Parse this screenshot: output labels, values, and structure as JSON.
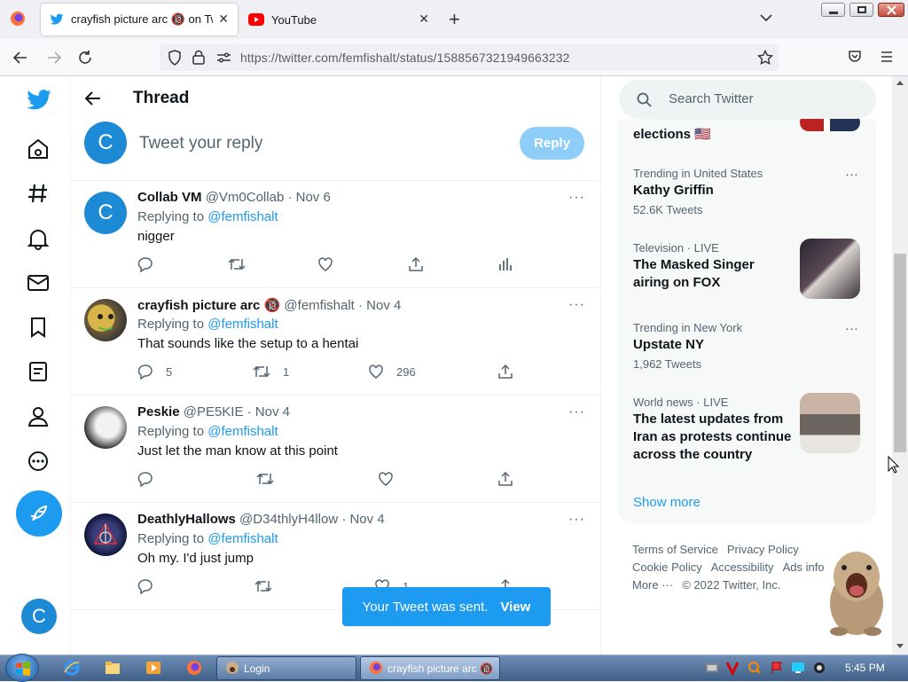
{
  "browser": {
    "tabs": [
      {
        "title": "crayfish picture arc 🔞 on Twitte",
        "close": "✕"
      },
      {
        "title": "YouTube",
        "close": "✕"
      }
    ],
    "new_tab": "+",
    "url": "https://twitter.com/femfishalt/status/1588567321949663232"
  },
  "header": {
    "title": "Thread"
  },
  "reply": {
    "avatar": "C",
    "placeholder": "Tweet your reply",
    "button": "Reply"
  },
  "tweets": [
    {
      "name": "Collab VM",
      "handle": "@Vm0Collab · Nov 6",
      "replying": "Replying to",
      "mention": "@femfishalt",
      "text": "nigger",
      "replies": "",
      "retweets": "",
      "likes": "",
      "avatar": "C"
    },
    {
      "name": "crayfish picture arc 🔞",
      "handle": "@femfishalt · Nov 4",
      "replying": "Replying to",
      "mention": "@femfishalt",
      "text": "That sounds like the setup to a hentai",
      "replies": "5",
      "retweets": "1",
      "likes": "296"
    },
    {
      "name": "Peskie",
      "handle": "@PE5KIE · Nov 4",
      "replying": "Replying to",
      "mention": "@femfishalt",
      "text": "Just let the man know at this point",
      "replies": "",
      "retweets": "",
      "likes": ""
    },
    {
      "name": "DeathlyHallows",
      "handle": "@D34thlyH4llow · Nov 4",
      "replying": "Replying to",
      "mention": "@femfishalt",
      "text": "Oh my. I'd just jump",
      "replies": "",
      "retweets": "",
      "likes": "1"
    }
  ],
  "toast": {
    "message": "Your Tweet was sent.",
    "action": "View"
  },
  "search": {
    "placeholder": "Search Twitter"
  },
  "trends": [
    {
      "context": "",
      "name": "elections 🇺🇸",
      "count": ""
    },
    {
      "context": "Trending in United States",
      "name": "Kathy Griffin",
      "count": "52.6K Tweets"
    },
    {
      "context": "Television · LIVE",
      "name": "The Masked Singer airing on FOX",
      "count": ""
    },
    {
      "context": "Trending in New York",
      "name": "Upstate NY",
      "count": "1,962 Tweets"
    },
    {
      "context": "World news · LIVE",
      "name": "The latest updates from Iran as protests continue across the country",
      "count": ""
    }
  ],
  "show_more": "Show more",
  "footer": [
    "Terms of Service",
    "Privacy Policy",
    "Cookie Policy",
    "Accessibility",
    "Ads info",
    "More ···",
    "© 2022 Twitter, Inc."
  ],
  "taskbar": {
    "tasks": [
      "Login",
      "crayfish picture arc 🔞..."
    ],
    "clock": "5:45 PM"
  },
  "colors": {
    "twitter_blue": "#1d9bf0",
    "text": "#0f1419",
    "muted": "#536471"
  }
}
